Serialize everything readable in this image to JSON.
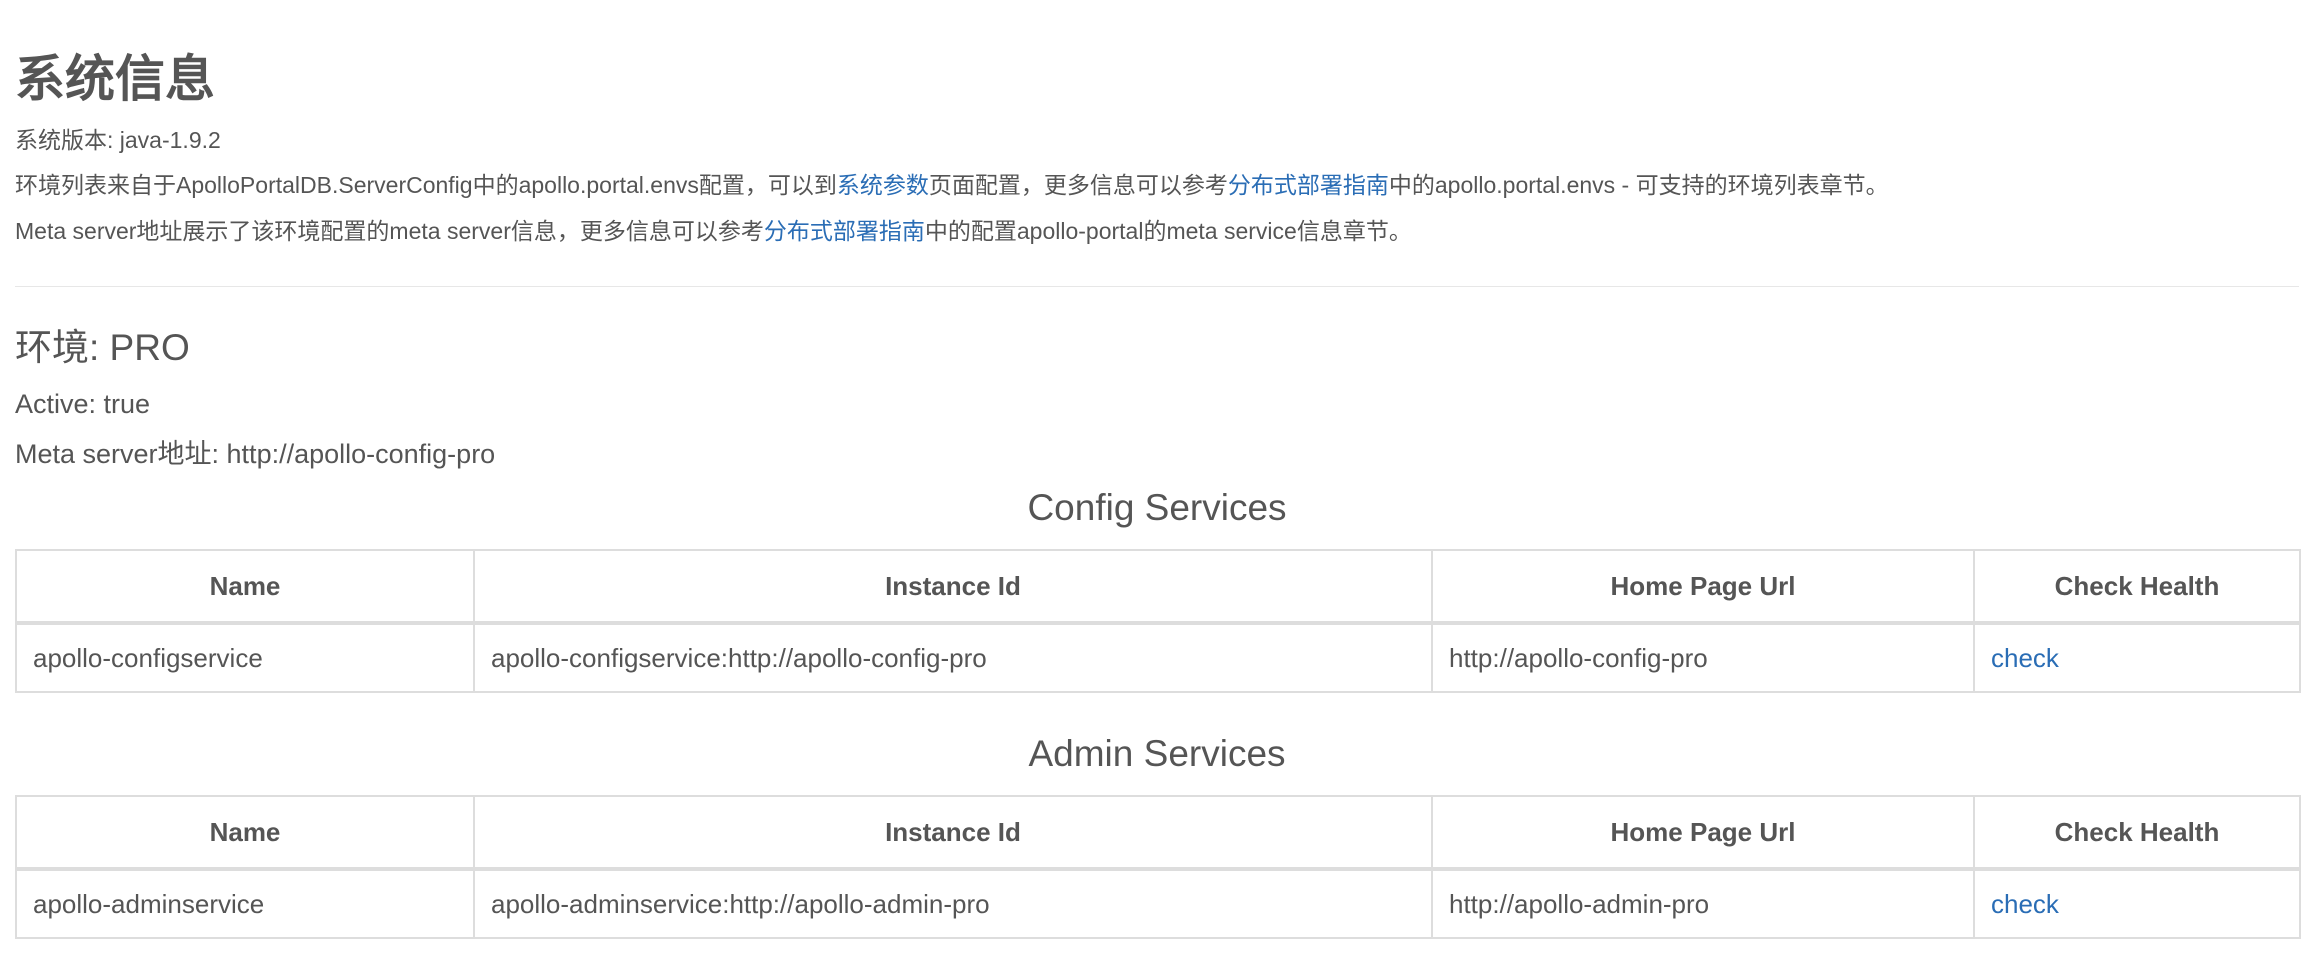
{
  "page_title": "系统信息",
  "system_version": "系统版本: java-1.9.2",
  "env_list_text": {
    "prefix": "环境列表来自于ApolloPortalDB.ServerConfig中的apollo.portal.envs配置，可以到",
    "link1": "系统参数",
    "middle": "页面配置，更多信息可以参考",
    "link2": "分布式部署指南",
    "suffix": "中的apollo.portal.envs - 可支持的环境列表章节。"
  },
  "meta_server_text": {
    "prefix": "Meta server地址展示了该环境配置的meta server信息，更多信息可以参考",
    "link": "分布式部署指南",
    "suffix": "中的配置apollo-portal的meta service信息章节。"
  },
  "environment": {
    "title": "环境: PRO",
    "active": "Active: true",
    "meta_server": "Meta server地址: http://apollo-config-pro"
  },
  "config_services": {
    "title": "Config Services",
    "headers": [
      "Name",
      "Instance Id",
      "Home Page Url",
      "Check Health"
    ],
    "rows": [
      {
        "name": "apollo-configservice",
        "instance_id": "apollo-configservice:http://apollo-config-pro",
        "home_page_url": "http://apollo-config-pro",
        "check": "check"
      }
    ]
  },
  "admin_services": {
    "title": "Admin Services",
    "headers": [
      "Name",
      "Instance Id",
      "Home Page Url",
      "Check Health"
    ],
    "rows": [
      {
        "name": "apollo-adminservice",
        "instance_id": "apollo-adminservice:http://apollo-admin-pro",
        "home_page_url": "http://apollo-admin-pro",
        "check": "check"
      }
    ]
  },
  "colors": {
    "text": "#555555",
    "link": "#2a6db5",
    "border": "#dddddd",
    "watermark": "#ff0000"
  }
}
